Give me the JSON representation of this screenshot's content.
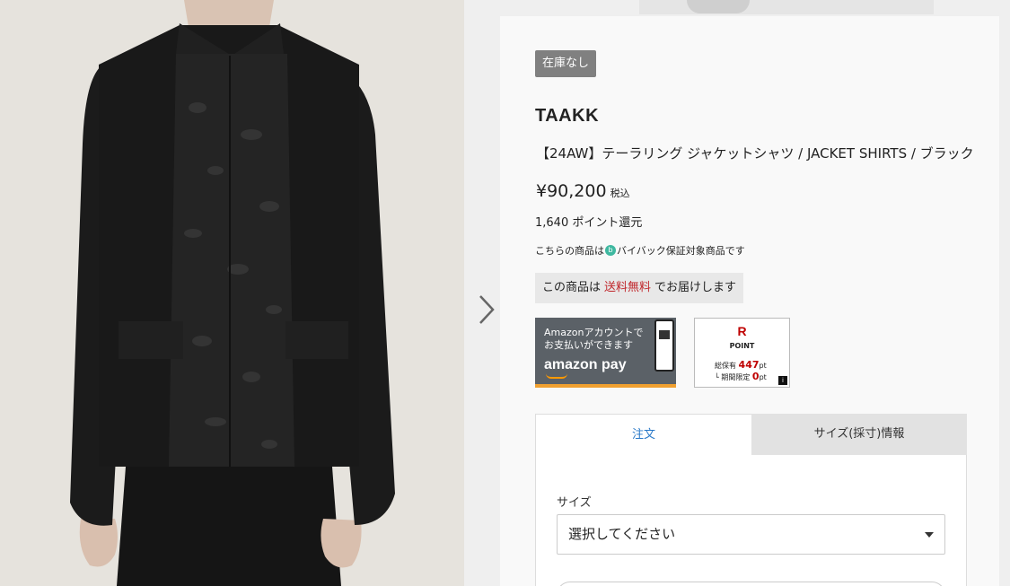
{
  "status": {
    "badge": "在庫なし"
  },
  "product": {
    "brand": "TAAKK",
    "title": "【24AW】テーラリング ジャケットシャツ / JACKET SHIRTS / ブラック",
    "price": "¥90,200",
    "tax_label": "税込",
    "points": "1,640 ポイント還元",
    "buyback_before": "こちらの商品は",
    "buyback_icon": "b",
    "buyback_after": "バイバック保証対象商品です"
  },
  "shipping": {
    "prefix": "この商品は",
    "highlight": "送料無料",
    "suffix": "でお届けします"
  },
  "amazon_pay": {
    "line1": "Amazonアカウントで",
    "line2": "お支払いができます",
    "logo": "amazon pay"
  },
  "rakuten_point": {
    "logo": "R",
    "label": "POINT",
    "held_prefix": "総保有",
    "held_value": "447",
    "held_unit": "pt",
    "limited_prefix": "└ 期間限定",
    "limited_value": "0",
    "limited_unit": "pt",
    "info": "i"
  },
  "tabs": [
    {
      "label": "注文"
    },
    {
      "label": "サイズ(採寸)情報"
    }
  ],
  "order": {
    "size_label": "サイズ",
    "size_value": "選択してください"
  },
  "colors": {
    "accent_link": "#2878c8",
    "free_shipping": "#c0262b",
    "badge_bg": "#808080",
    "rakuten_red": "#bf0000",
    "amazon_orange": "#f0a030"
  },
  "icons": {
    "next": "chevron-right-icon",
    "dropdown": "caret-down-icon",
    "buyback": "buyback-logo-icon",
    "info": "info-icon"
  }
}
